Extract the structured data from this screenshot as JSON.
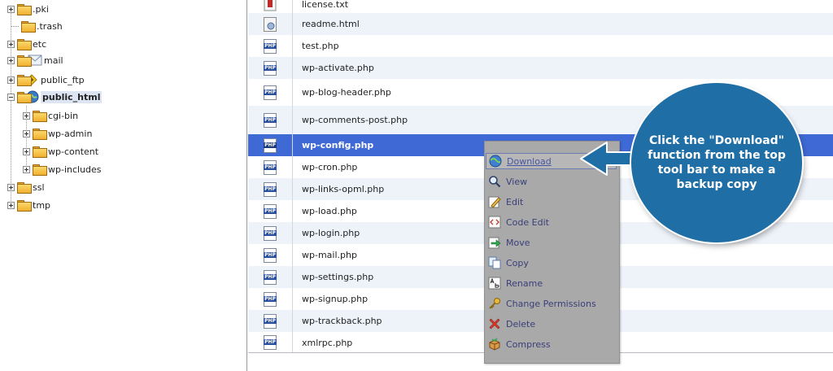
{
  "tree": {
    "items": [
      {
        "label": ".pki",
        "expander": "plus"
      },
      {
        "label": ".trash",
        "expander": "none"
      },
      {
        "label": "etc",
        "expander": "plus"
      },
      {
        "label": "mail",
        "expander": "plus",
        "icon": "mail-envelope-icon"
      },
      {
        "label": "public_ftp",
        "expander": "plus",
        "icon": "ftp-icon"
      },
      {
        "label": "public_html",
        "expander": "minus",
        "icon": "globe-icon",
        "selected": true
      },
      {
        "label": "cgi-bin",
        "expander": "plus"
      },
      {
        "label": "wp-admin",
        "expander": "plus"
      },
      {
        "label": "wp-content",
        "expander": "plus"
      },
      {
        "label": "wp-includes",
        "expander": "plus"
      },
      {
        "label": "ssl",
        "expander": "plus"
      },
      {
        "label": "tmp",
        "expander": "plus"
      }
    ]
  },
  "files": {
    "rows": [
      {
        "name": "license.txt",
        "icon": "text-file-icon"
      },
      {
        "name": "readme.html",
        "icon": "html-file-icon"
      },
      {
        "name": "test.php",
        "icon": "php-file-icon"
      },
      {
        "name": "wp-activate.php",
        "icon": "php-file-icon"
      },
      {
        "name": "wp-blog-header.php",
        "icon": "php-file-icon"
      },
      {
        "name": "wp-comments-post.php",
        "icon": "php-file-icon"
      },
      {
        "name": "wp-config.php",
        "icon": "php-file-icon",
        "selected": true
      },
      {
        "name": "wp-cron.php",
        "icon": "php-file-icon"
      },
      {
        "name": "wp-links-opml.php",
        "icon": "php-file-icon"
      },
      {
        "name": "wp-load.php",
        "icon": "php-file-icon"
      },
      {
        "name": "wp-login.php",
        "icon": "php-file-icon"
      },
      {
        "name": "wp-mail.php",
        "icon": "php-file-icon"
      },
      {
        "name": "wp-settings.php",
        "icon": "php-file-icon"
      },
      {
        "name": "wp-signup.php",
        "icon": "php-file-icon"
      },
      {
        "name": "wp-trackback.php",
        "icon": "php-file-icon"
      },
      {
        "name": "xmlrpc.php",
        "icon": "php-file-icon"
      }
    ],
    "php_icon_text": "PHP",
    "selected_color": "#3f69d4",
    "alt_row_color": "#eef3f9"
  },
  "context_menu": {
    "items": [
      {
        "label": "Download",
        "icon": "download-globe-icon",
        "highlighted": true
      },
      {
        "label": "View",
        "icon": "magnifier-icon"
      },
      {
        "label": "Edit",
        "icon": "pencil-icon"
      },
      {
        "label": "Code Edit",
        "icon": "code-edit-icon"
      },
      {
        "label": "Move",
        "icon": "move-arrow-icon"
      },
      {
        "label": "Copy",
        "icon": "copy-pages-icon"
      },
      {
        "label": "Rename",
        "icon": "rename-icon"
      },
      {
        "label": "Change Permissions",
        "icon": "key-icon"
      },
      {
        "label": "Delete",
        "icon": "delete-x-icon"
      },
      {
        "label": "Compress",
        "icon": "compress-box-icon"
      }
    ],
    "background": "#a9a9a9"
  },
  "callout": {
    "text": "Click the \"Download\" function from the top tool bar to make a backup copy",
    "color": "#1f6fa6"
  }
}
